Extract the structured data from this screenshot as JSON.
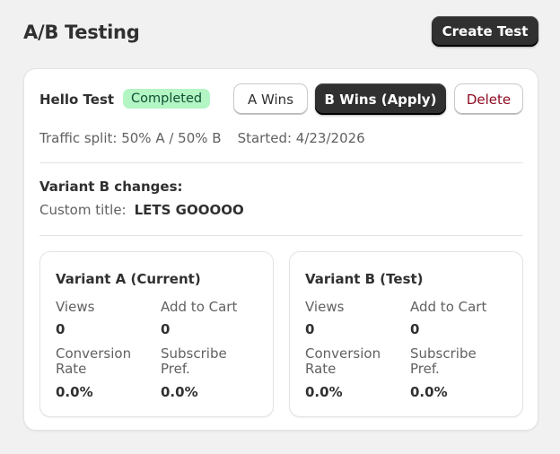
{
  "header": {
    "title": "A/B Testing",
    "create_label": "Create Test"
  },
  "test": {
    "name": "Hello Test",
    "status": "Completed",
    "actions": {
      "a_wins": "A Wins",
      "b_wins": "B Wins (Apply)",
      "delete": "Delete"
    },
    "traffic_split": "Traffic split: 50% A / 50% B",
    "started": "Started: 4/23/2026",
    "changes_heading": "Variant B changes:",
    "changes": {
      "label": "Custom title:",
      "value": "LETS GOOOOO"
    },
    "variants": [
      {
        "title": "Variant A (Current)",
        "views_label": "Views",
        "views": "0",
        "atc_label": "Add to Cart",
        "atc": "0",
        "cr_label_1": "Conversion",
        "cr_label_2": "Rate",
        "cr": "0.0%",
        "sp_label_1": "Subscribe",
        "sp_label_2": "Pref.",
        "sp": "0.0%"
      },
      {
        "title": "Variant B (Test)",
        "views_label": "Views",
        "views": "0",
        "atc_label": "Add to Cart",
        "atc": "0",
        "cr_label_1": "Conversion",
        "cr_label_2": "Rate",
        "cr": "0.0%",
        "sp_label_1": "Subscribe",
        "sp_label_2": "Pref.",
        "sp": "0.0%"
      }
    ]
  },
  "colors": {
    "badge_bg": "#b4f5c4",
    "badge_text": "#0c5132",
    "primary": "#303030",
    "danger_text": "#8e0b21"
  }
}
